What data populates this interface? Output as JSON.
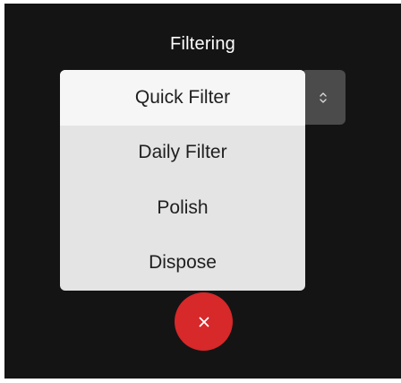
{
  "dialog": {
    "title": "Filtering"
  },
  "filter_select": {
    "toggle_icon": "chevron-up-down-icon",
    "selected_index": 0,
    "options": [
      {
        "label": "Quick Filter"
      },
      {
        "label": "Daily Filter"
      },
      {
        "label": "Polish"
      },
      {
        "label": "Dispose"
      }
    ]
  },
  "close_button": {
    "icon": "close-icon"
  },
  "colors": {
    "background": "#141414",
    "menu_bg": "#e4e4e4",
    "menu_selected_bg": "#f6f6f6",
    "toggle_bg": "#4b4b4b",
    "close_bg": "#d7282a"
  }
}
